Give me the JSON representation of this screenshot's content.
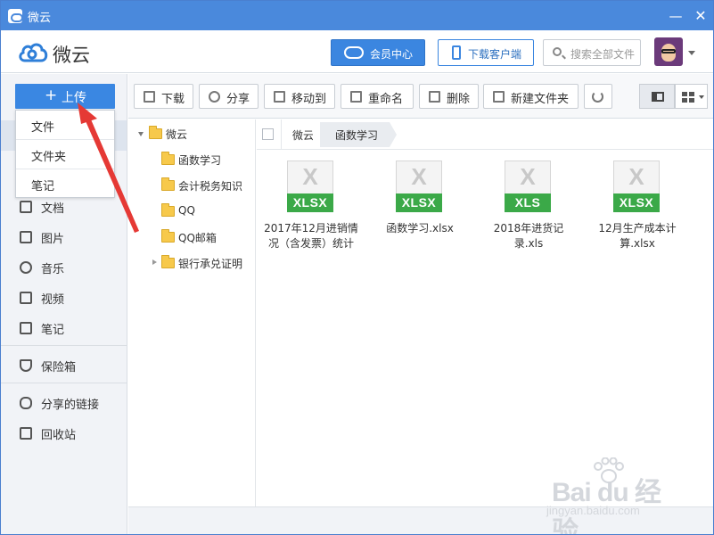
{
  "window": {
    "title": "微云",
    "minimize_icon": "minimize-icon",
    "close_icon": "close-icon",
    "close_glyph": "✕",
    "minimize_glyph": "—"
  },
  "header": {
    "logo_text": "微云",
    "vip_label": "会员中心",
    "download_client_label": "下载客户端",
    "search_placeholder": "搜索全部文件"
  },
  "sidebar": {
    "upload_label": "上传",
    "upload_plus": "+",
    "items": [
      {
        "label": "文档",
        "icon": "document-icon"
      },
      {
        "label": "图片",
        "icon": "image-icon"
      },
      {
        "label": "音乐",
        "icon": "music-icon"
      },
      {
        "label": "视频",
        "icon": "video-icon"
      },
      {
        "label": "笔记",
        "icon": "note-icon"
      },
      {
        "label": "保险箱",
        "icon": "shield-icon"
      },
      {
        "label": "分享的链接",
        "icon": "link-icon"
      },
      {
        "label": "回收站",
        "icon": "trash-icon"
      }
    ]
  },
  "upload_menu": {
    "items": [
      "文件",
      "文件夹",
      "笔记"
    ]
  },
  "toolbar": {
    "download": "下载",
    "share": "分享",
    "move_to": "移动到",
    "rename": "重命名",
    "delete": "删除",
    "new_folder": "新建文件夹",
    "refresh_icon": "refresh-icon"
  },
  "tree": {
    "root": "微云",
    "children": [
      "函数学习",
      "会计税务知识",
      "QQ",
      "QQ邮箱",
      "银行承兑证明"
    ]
  },
  "breadcrumb": [
    "微云",
    "函数学习"
  ],
  "files": [
    {
      "name": "2017年12月进销情况（含发票）统计",
      "ext": "XLSX"
    },
    {
      "name": "函数学习.xlsx",
      "ext": "XLSX"
    },
    {
      "name": "2018年进货记录.xls",
      "ext": "XLS"
    },
    {
      "name": "12月生产成本计算.xlsx",
      "ext": "XLSX"
    }
  ],
  "file_icon_letter": "X",
  "watermark": {
    "line1": "Bai du 经验",
    "line2": "jingyan.baidu.com"
  },
  "colors": {
    "accent": "#3a87e2",
    "title_bar": "#4a89dc",
    "excel_green": "#3ba948",
    "annotation_red": "#e53935"
  }
}
